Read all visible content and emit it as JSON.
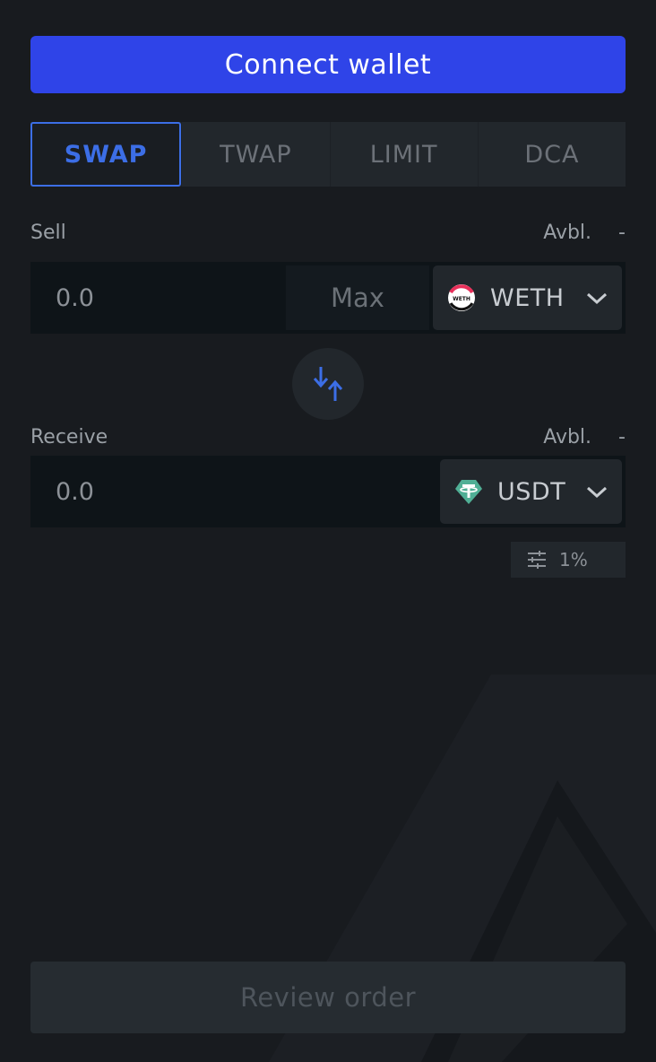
{
  "header": {
    "connect_label": "Connect wallet"
  },
  "tabs": [
    {
      "label": "SWAP",
      "active": true
    },
    {
      "label": "TWAP",
      "active": false
    },
    {
      "label": "LIMIT",
      "active": false
    },
    {
      "label": "DCA",
      "active": false
    }
  ],
  "sell": {
    "label": "Sell",
    "avbl_label": "Avbl.",
    "avbl_value": "-",
    "amount": "0.0",
    "max_label": "Max",
    "token": "WETH",
    "token_icon": "weth-token-icon"
  },
  "receive": {
    "label": "Receive",
    "avbl_label": "Avbl.",
    "avbl_value": "-",
    "amount": "0.0",
    "token": "USDT",
    "token_icon": "usdt-token-icon"
  },
  "slippage": {
    "value": "1%",
    "icon": "sliders-icon"
  },
  "footer": {
    "review_label": "Review order"
  },
  "colors": {
    "background": "#181b1f",
    "accent": "#2f44e8",
    "active_tab": "#3c6ee6",
    "usdt": "#50af95"
  }
}
